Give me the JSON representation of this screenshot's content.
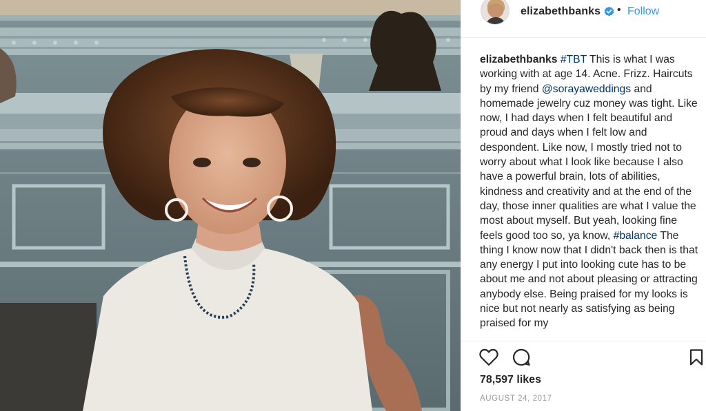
{
  "post": {
    "username": "elizabethbanks",
    "follow_label": "Follow",
    "dot": "•",
    "photo_description_icon": "photo-icon"
  },
  "caption": {
    "username": "elizabethbanks",
    "part1": " ",
    "hashtag1": "#TBT",
    "part2": " This is what I was working with at age 14. Acne. Frizz. Haircuts by my friend ",
    "mention": "@sorayaweddings",
    "part3": " and homemade jewelry cuz money was tight. Like now, I had days when I felt beautiful and proud and days when I felt low and despondent. Like now, I mostly tried not to worry about what I look like because I also have a powerful brain, lots of abilities, kindness and creativity and at the end of the day, those inner qualities are what I value the most about myself. But yeah, looking fine feels good too so, ya know, ",
    "hashtag2": "#balance",
    "part4": " The thing I know now that I didn't back then is that any energy I put into looking cute has to be about me and not about pleasing or attracting anybody else. Being praised for my looks is nice but not nearly as satisfying as being praised for my"
  },
  "stats": {
    "likes": "78,597 likes",
    "date": "AUGUST 24, 2017"
  },
  "colors": {
    "follow": "#3897f0",
    "link": "#003569",
    "verified": "#3897f0",
    "date": "#999999"
  }
}
